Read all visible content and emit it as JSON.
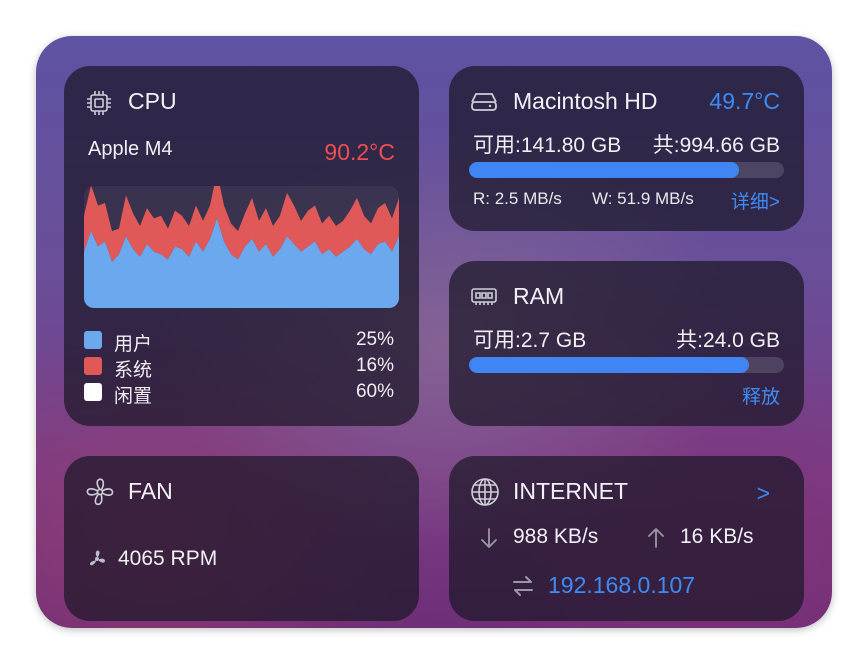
{
  "cpu": {
    "title": "CPU",
    "icon": "cpu-icon",
    "model": "Apple M4",
    "temperature": "90.2°C",
    "legend": [
      {
        "name": "用户",
        "value": "25%",
        "color": "#6ba8ee"
      },
      {
        "name": "系统",
        "value": "16%",
        "color": "#e05858"
      },
      {
        "name": "闲置",
        "value": "60%",
        "color": "#ffffff"
      }
    ]
  },
  "chart_data": {
    "type": "area",
    "series": [
      {
        "name": "用户",
        "color": "#6ba8ee",
        "values": [
          22,
          30,
          24,
          26,
          18,
          21,
          28,
          23,
          20,
          25,
          22,
          21,
          19,
          24,
          23,
          20,
          26,
          22,
          27,
          35,
          26,
          21,
          19,
          24,
          27,
          22,
          25,
          20,
          23,
          28,
          25,
          22,
          24,
          26,
          21,
          23,
          20,
          22,
          24,
          27,
          23,
          21,
          25,
          26,
          22,
          28
        ]
      },
      {
        "name": "系统",
        "color": "#e05858",
        "values": [
          14,
          18,
          16,
          15,
          12,
          10,
          16,
          14,
          12,
          14,
          13,
          15,
          12,
          14,
          13,
          12,
          14,
          12,
          13,
          18,
          14,
          12,
          11,
          13,
          16,
          12,
          14,
          12,
          13,
          17,
          15,
          12,
          14,
          14,
          12,
          13,
          12,
          12,
          14,
          16,
          13,
          12,
          14,
          15,
          13,
          15
        ]
      }
    ],
    "ylim": [
      0,
      100
    ],
    "stacked": true
  },
  "disk": {
    "title": "Macintosh HD",
    "icon": "hard-drive-icon",
    "temperature": "49.7°C",
    "available": "可用:141.80 GB",
    "total": "共:994.66 GB",
    "used_fraction": 0.857,
    "read": "R: 2.5 MB/s",
    "write": "W: 51.9 MB/s",
    "detail_link": "详细>"
  },
  "ram": {
    "title": "RAM",
    "icon": "memory-chip-icon",
    "available": "可用:2.7 GB",
    "total": "共:24.0 GB",
    "used_fraction": 0.888,
    "release_button": "释放"
  },
  "fan": {
    "title": "FAN",
    "icon": "fan-icon",
    "speed": "4065 RPM"
  },
  "network": {
    "title": "INTERNET",
    "icon": "globe-icon",
    "more_link": ">",
    "download": "988 KB/s",
    "upload": "16 KB/s",
    "ip": "192.168.0.107"
  },
  "colors": {
    "accent_blue": "#3d8cf5",
    "temp_red": "#ec5050",
    "bar_blue": "#3f86f4"
  }
}
